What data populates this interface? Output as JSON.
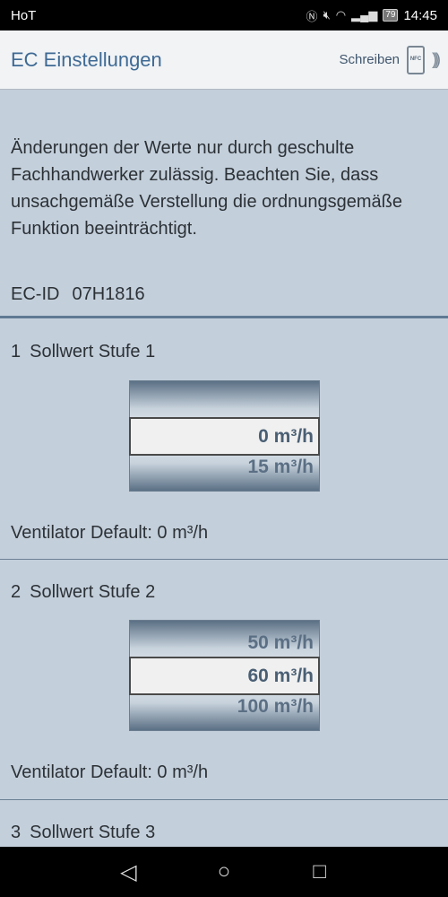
{
  "status_bar": {
    "carrier": "HoT",
    "battery": "79",
    "time": "14:45"
  },
  "app_bar": {
    "title": "EC Einstellungen",
    "write_label": "Schreiben",
    "nfc_label": "NFC"
  },
  "warning_text": "Änderungen der Werte nur durch geschulte Fachhandwerker zulässig. Beachten Sie, dass unsachgemäße Verstellung die ordnungsgemäße Funktion beeinträchtigt.",
  "ec_id": {
    "label": "EC-ID",
    "value": "07H1816"
  },
  "sections": [
    {
      "number": "1",
      "title": "Sollwert Stufe 1",
      "picker": {
        "above": "",
        "selected": "0 m³/h",
        "below": "15 m³/h"
      },
      "default": "Ventilator Default: 0 m³/h"
    },
    {
      "number": "2",
      "title": "Sollwert Stufe 2",
      "picker": {
        "above": "50 m³/h",
        "selected": "60 m³/h",
        "below": "100 m³/h"
      },
      "default": "Ventilator Default: 0 m³/h"
    },
    {
      "number": "3",
      "title": "Sollwert Stufe 3"
    }
  ],
  "icons": {
    "signal": "signal-icon",
    "wifi": "wifi-icon",
    "mute": "mute-icon",
    "nfc": "nfc-icon"
  }
}
